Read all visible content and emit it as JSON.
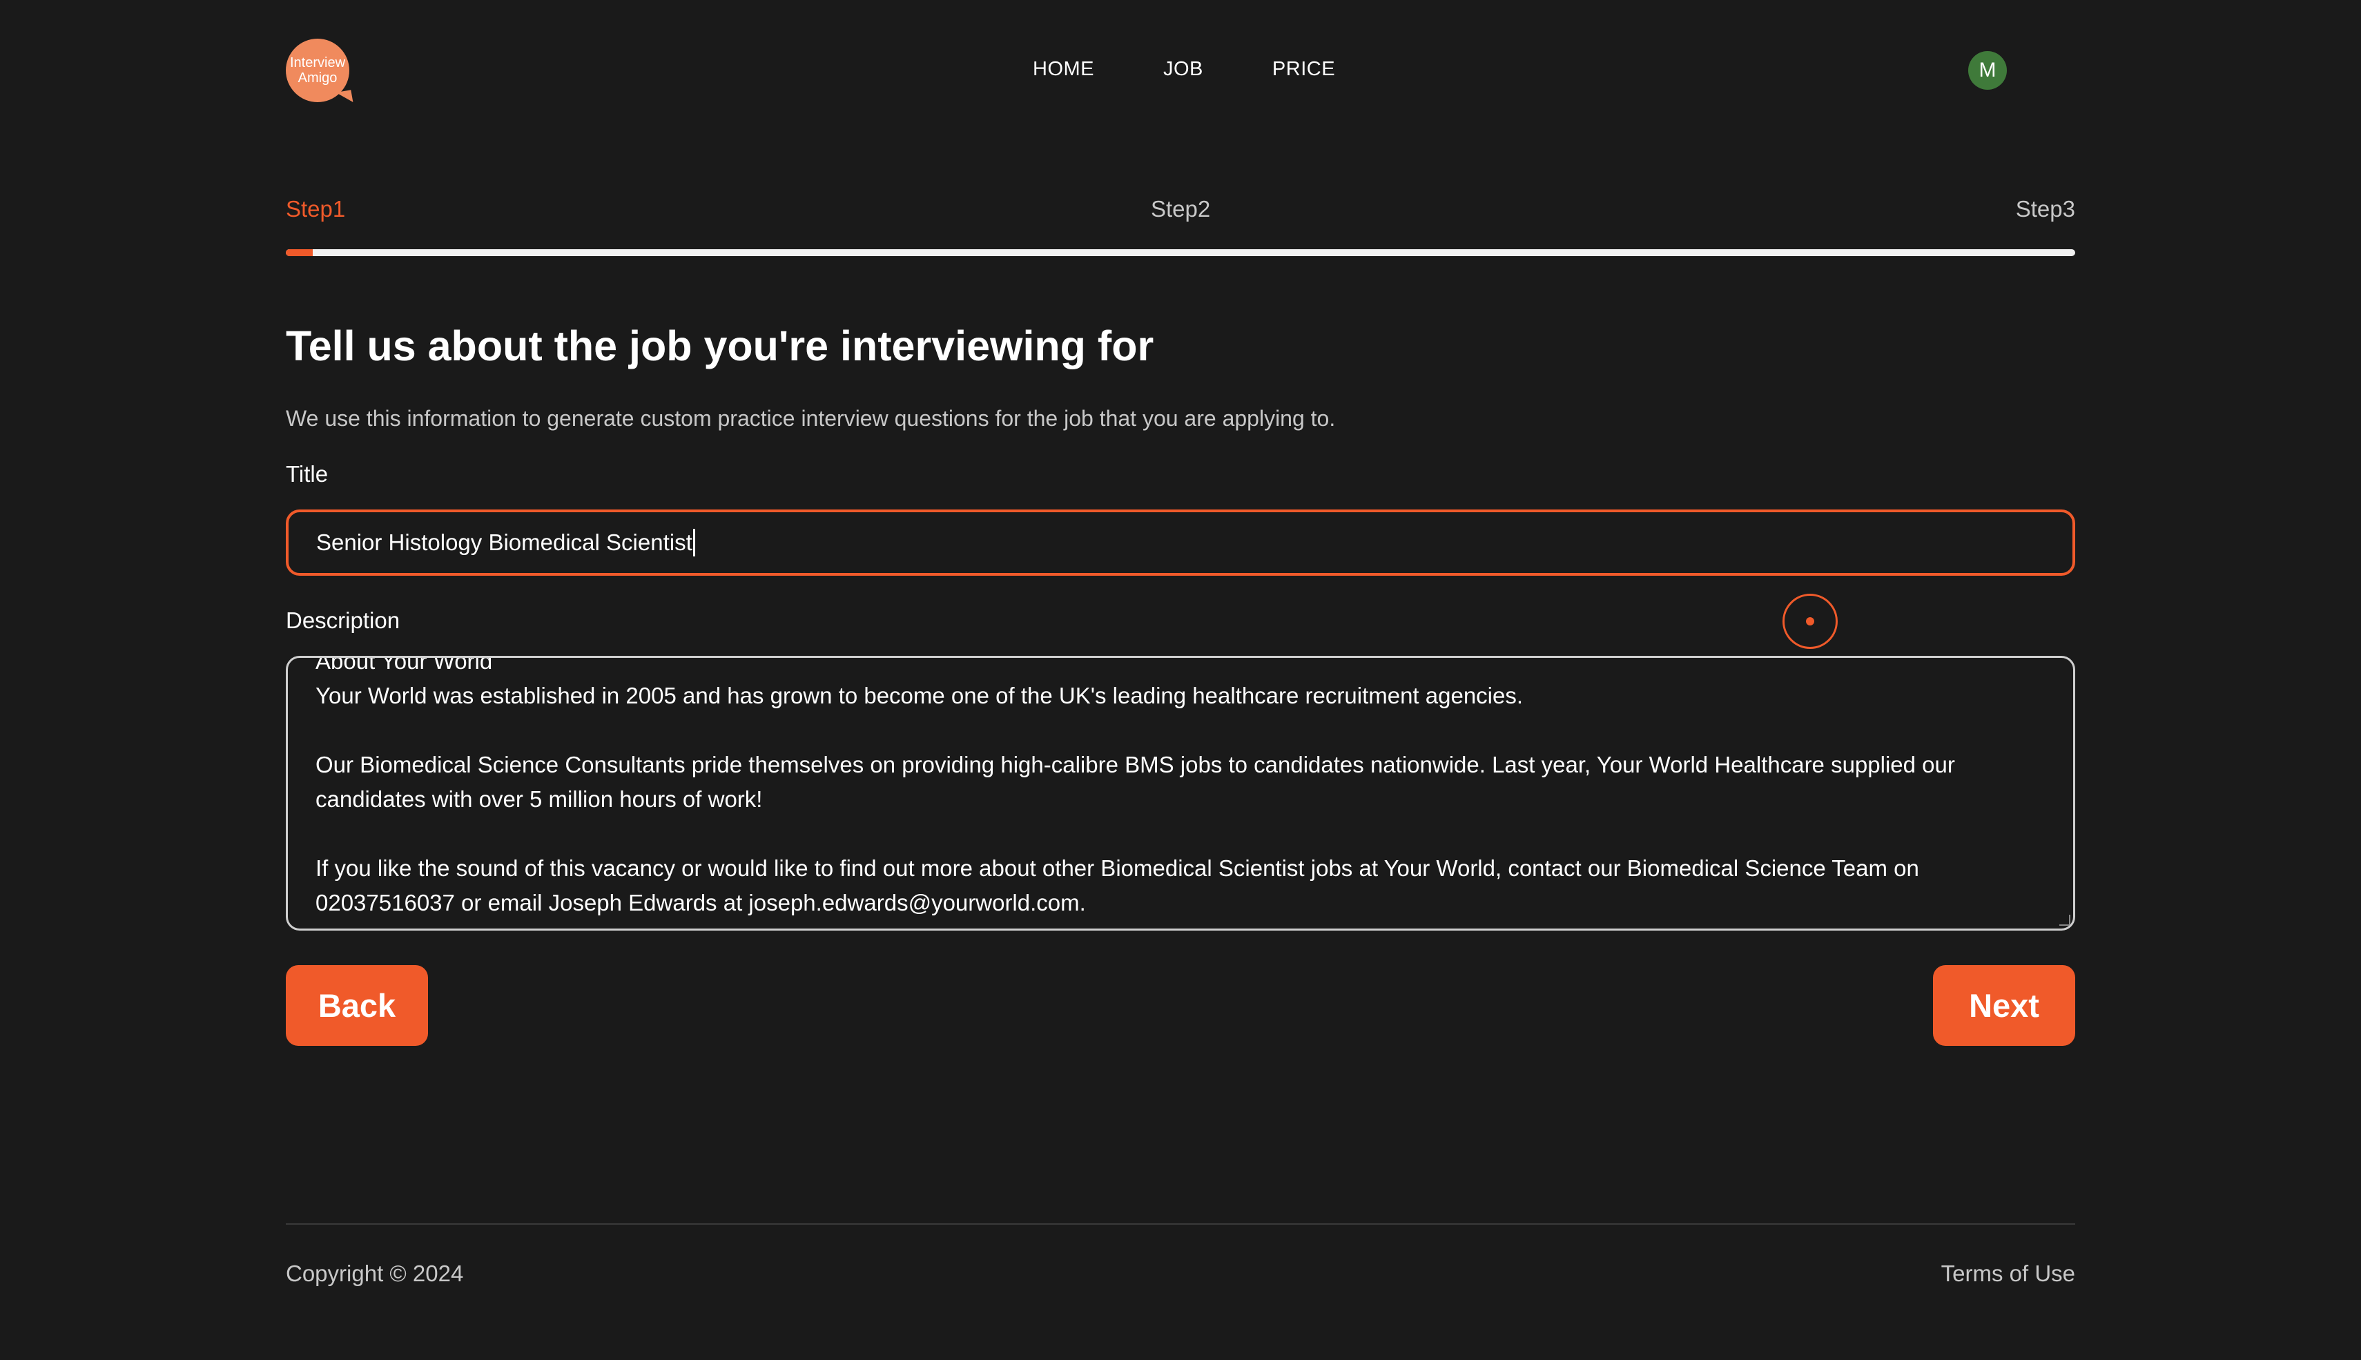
{
  "header": {
    "logo_line1": "Interview",
    "logo_line2": "Amigo",
    "nav": [
      "HOME",
      "JOB",
      "PRICE"
    ],
    "avatar_initial": "M"
  },
  "steps": {
    "labels": [
      "Step1",
      "Step2",
      "Step3"
    ],
    "active": "Step1",
    "progress_fraction": 0.015
  },
  "form": {
    "heading": "Tell us about the job you're interviewing for",
    "subheading": "We use this information to generate custom practice interview questions for the job that you are applying to.",
    "title_label": "Title",
    "title_value": "Senior Histology Biomedical Scientist",
    "description_label": "Description",
    "description_paragraphs": [
      "About Your World",
      "Your World was established in 2005 and has grown to become one of the UK's leading healthcare recruitment agencies.",
      "",
      "Our Biomedical Science Consultants pride themselves on providing high-calibre BMS jobs to candidates nationwide. Last year, Your World Healthcare supplied our candidates with over 5 million hours of work!",
      "",
      "If you like the sound of this vacancy or would like to find out more about other Biomedical Scientist jobs at Your World, contact our Biomedical Science Team on 02037516037 or email Joseph Edwards at joseph.edwards@yourworld.com."
    ],
    "back_label": "Back",
    "next_label": "Next"
  },
  "footer": {
    "copyright": "Copyright © 2024",
    "terms": "Terms of Use"
  },
  "colors": {
    "background": "#1a1a1a",
    "accent": "#f05a2a",
    "logo": "#f08a5d",
    "avatar": "#3f7a3a"
  }
}
